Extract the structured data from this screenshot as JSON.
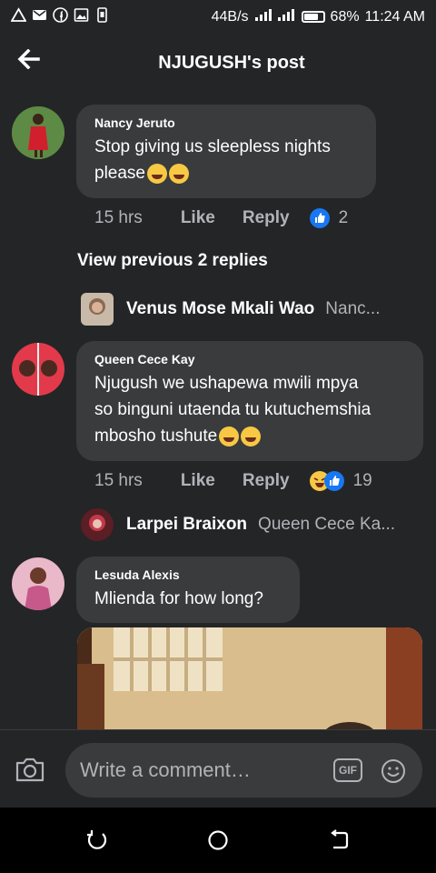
{
  "status": {
    "speed": "44B/s",
    "battery": "68%",
    "time": "11:24 AM",
    "icons": [
      "warning-icon",
      "mail-icon",
      "facebook-icon",
      "image-icon",
      "phone-storage-icon"
    ]
  },
  "header": {
    "title": "NJUGUSH's post"
  },
  "comments": [
    {
      "name": "Nancy Jeruto",
      "text_line1": "Stop giving us sleepless nights",
      "text_line2": "please",
      "time": "15 hrs",
      "like": "Like",
      "reply": "Reply",
      "reaction_count": "2"
    },
    {
      "name": "Queen Cece Kay",
      "text_line1": "Njugush we ushapewa mwili mpya",
      "text_line2": "so binguni utaenda tu kutuchemshia",
      "text_line3": "mbosho tushute",
      "time": "15 hrs",
      "like": "Like",
      "reply": "Reply",
      "reaction_count": "19"
    },
    {
      "name": "Lesuda Alexis",
      "text_line1": "Mlienda for how long?"
    }
  ],
  "view_previous": "View previous 2 replies",
  "replies": [
    {
      "name": "Venus Mose Mkali Wao",
      "preview": "Nanc..."
    },
    {
      "name": "Larpei Braixon",
      "preview": "Queen Cece Ka..."
    }
  ],
  "composer": {
    "placeholder": "Write a comment…",
    "gif_label": "GIF"
  },
  "colors": {
    "background": "#242527",
    "bubble": "#3a3b3c",
    "like_blue": "#1877f2"
  }
}
